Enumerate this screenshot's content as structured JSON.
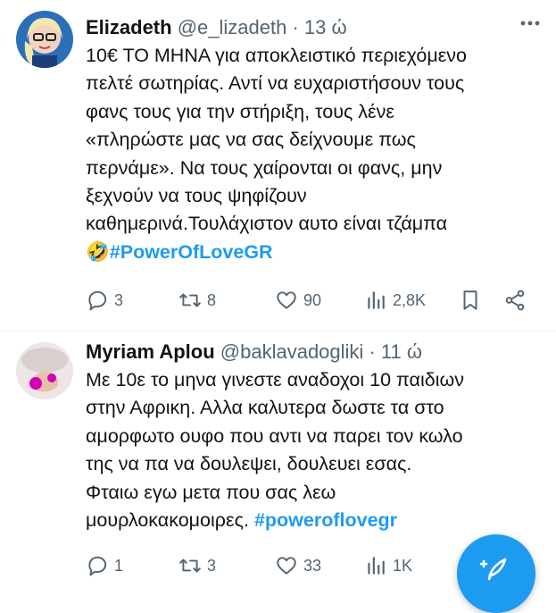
{
  "tweets": [
    {
      "author_name": "Elizadeth",
      "handle": "@e_lizadeth",
      "dot": "·",
      "time": "13 ώ",
      "text_lines": [
        "10€ ΤΟ ΜΗΝΑ για αποκλειστικό περιεχόμενο",
        "πελτέ σωτηρίας. Αντί να ευχαριστήσουν τους",
        "φανς τους για την στήριξη, τους λένε",
        "«πληρώστε μας να σας δείχνουμε πως",
        "περνάμε». Να τους χαίρονται οι φανς, μην",
        "ξεχνούν να τους ψηφίζουν",
        "καθημερινά.Τουλάχιστον αυτο είναι τζάμπα"
      ],
      "emoji": "🤣",
      "hashtag": "#PowerOfLoveGR",
      "replies": "3",
      "retweets": "8",
      "likes": "90",
      "views": "2,8K"
    },
    {
      "author_name": "Myriam Aplou",
      "handle": "@baklavadogliki",
      "dot": "·",
      "time": "11 ώ",
      "text_lines": [
        "Με 10ε το μηνα γινεστε αναδοχοι 10 παιδιων",
        "στην Αφρικη. Αλλα καλυτερα δωστε τα στο",
        "αμορφωτο ουφο που αντι να παρει τον κωλο",
        "της να πα να δουλεψει, δουλευει εσας.",
        "Φταιω εγω μετα που σας λεω",
        "μουρλοκακομοιρες."
      ],
      "hashtag": "#poweroflovegr",
      "replies": "1",
      "retweets": "3",
      "likes": "33",
      "views": "1K"
    }
  ],
  "colors": {
    "accent": "#1d9bf0",
    "text": "#0f1419",
    "muted": "#536471"
  }
}
